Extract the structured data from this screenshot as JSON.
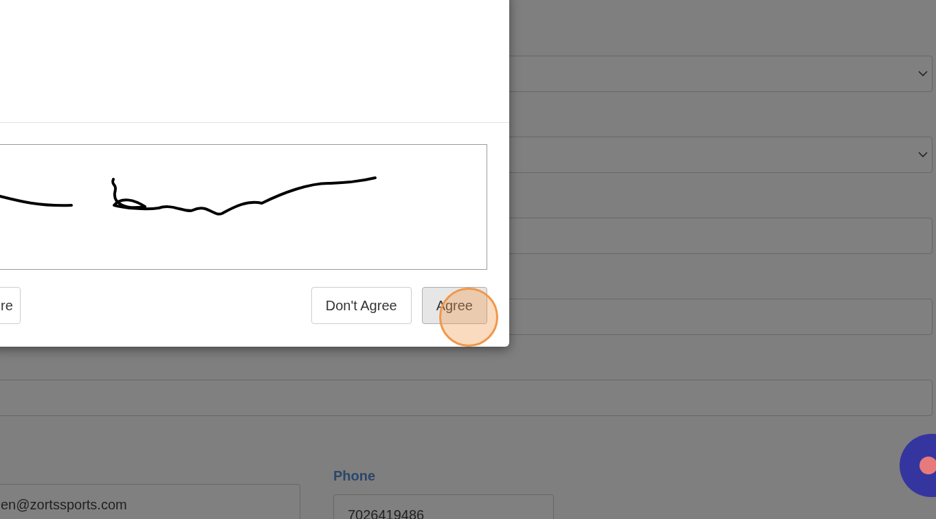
{
  "background_form": {
    "fields": [
      {
        "kind": "select"
      },
      {
        "kind": "select"
      },
      {
        "kind": "input"
      },
      {
        "kind": "input"
      },
      {
        "kind": "input"
      }
    ],
    "email": {
      "value": "en@zortssports.com"
    },
    "phone": {
      "label": "Phone",
      "value": "7026419486"
    }
  },
  "modal": {
    "buttons": [
      {
        "label": "re",
        "pressed": false
      },
      {
        "label": "Don't Agree",
        "pressed": false
      },
      {
        "label": "Agree",
        "pressed": true
      }
    ]
  }
}
